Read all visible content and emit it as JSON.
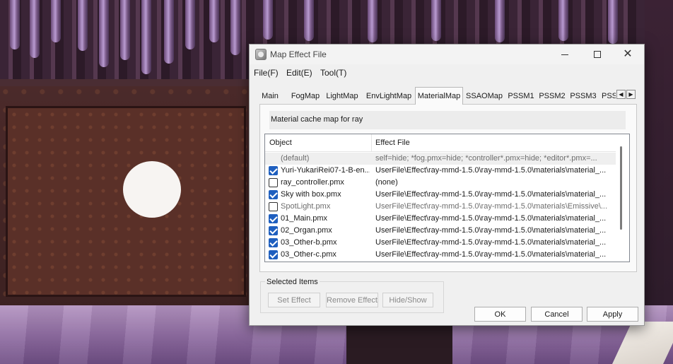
{
  "window": {
    "title": "Map Effect File"
  },
  "menu": [
    {
      "label": "File(F)"
    },
    {
      "label": "Edit(E)"
    },
    {
      "label": "Tool(T)"
    }
  ],
  "tabs": [
    "Main",
    "FogMap",
    "LightMap",
    "EnvLightMap",
    "MaterialMap",
    "SSAOMap",
    "PSSM1",
    "PSSM2",
    "PSSM3",
    "PSSM"
  ],
  "active_tab": "MaterialMap",
  "description": "Material cache map for ray",
  "table": {
    "columns": [
      "Object",
      "Effect File"
    ],
    "rows": [
      {
        "object": "(default)",
        "effect": "self=hide; *fog.pmx=hide; *controller*.pmx=hide; *editor*.pmx=...",
        "checkbox": false,
        "checked": false,
        "dim": true,
        "selected": true
      },
      {
        "object": "Yuri-YukariRei07-1-B-en...",
        "effect": "UserFile\\Effect\\ray-mmd-1.5.0\\ray-mmd-1.5.0\\materials\\material_...",
        "checkbox": true,
        "checked": true,
        "dim": false,
        "selected": false
      },
      {
        "object": "ray_controller.pmx",
        "effect": "(none)",
        "checkbox": true,
        "checked": false,
        "dim": false,
        "selected": false
      },
      {
        "object": "Sky with box.pmx",
        "effect": "UserFile\\Effect\\ray-mmd-1.5.0\\ray-mmd-1.5.0\\materials\\material_...",
        "checkbox": true,
        "checked": true,
        "dim": false,
        "selected": false
      },
      {
        "object": "SpotLight.pmx",
        "effect": "UserFile\\Effect\\ray-mmd-1.5.0\\ray-mmd-1.5.0\\materials\\Emissive\\...",
        "checkbox": true,
        "checked": false,
        "dim": true,
        "selected": false
      },
      {
        "object": "01_Main.pmx",
        "effect": "UserFile\\Effect\\ray-mmd-1.5.0\\ray-mmd-1.5.0\\materials\\material_...",
        "checkbox": true,
        "checked": true,
        "dim": false,
        "selected": false
      },
      {
        "object": "02_Organ.pmx",
        "effect": "UserFile\\Effect\\ray-mmd-1.5.0\\ray-mmd-1.5.0\\materials\\material_...",
        "checkbox": true,
        "checked": true,
        "dim": false,
        "selected": false
      },
      {
        "object": "03_Other-b.pmx",
        "effect": "UserFile\\Effect\\ray-mmd-1.5.0\\ray-mmd-1.5.0\\materials\\material_...",
        "checkbox": true,
        "checked": true,
        "dim": false,
        "selected": false
      },
      {
        "object": "03_Other-c.pmx",
        "effect": "UserFile\\Effect\\ray-mmd-1.5.0\\ray-mmd-1.5.0\\materials\\material_...",
        "checkbox": true,
        "checked": true,
        "dim": false,
        "selected": false
      }
    ]
  },
  "selected_items": {
    "label": "Selected Items",
    "buttons": [
      "Set Effect",
      "Remove Effect",
      "Hide/Show"
    ]
  },
  "dialog_buttons": {
    "ok": "OK",
    "cancel": "Cancel",
    "apply": "Apply"
  },
  "icons": {
    "app": "app-icon",
    "minimize": "minimize-icon",
    "maximize": "maximize-icon",
    "close": "close-icon",
    "tab_left": "chevron-left-icon",
    "tab_right": "chevron-right-icon"
  },
  "colors": {
    "checkbox_checked": "#1f5fbf",
    "dialog_bg": "#f0f0f0",
    "list_bg": "#ffffff"
  }
}
